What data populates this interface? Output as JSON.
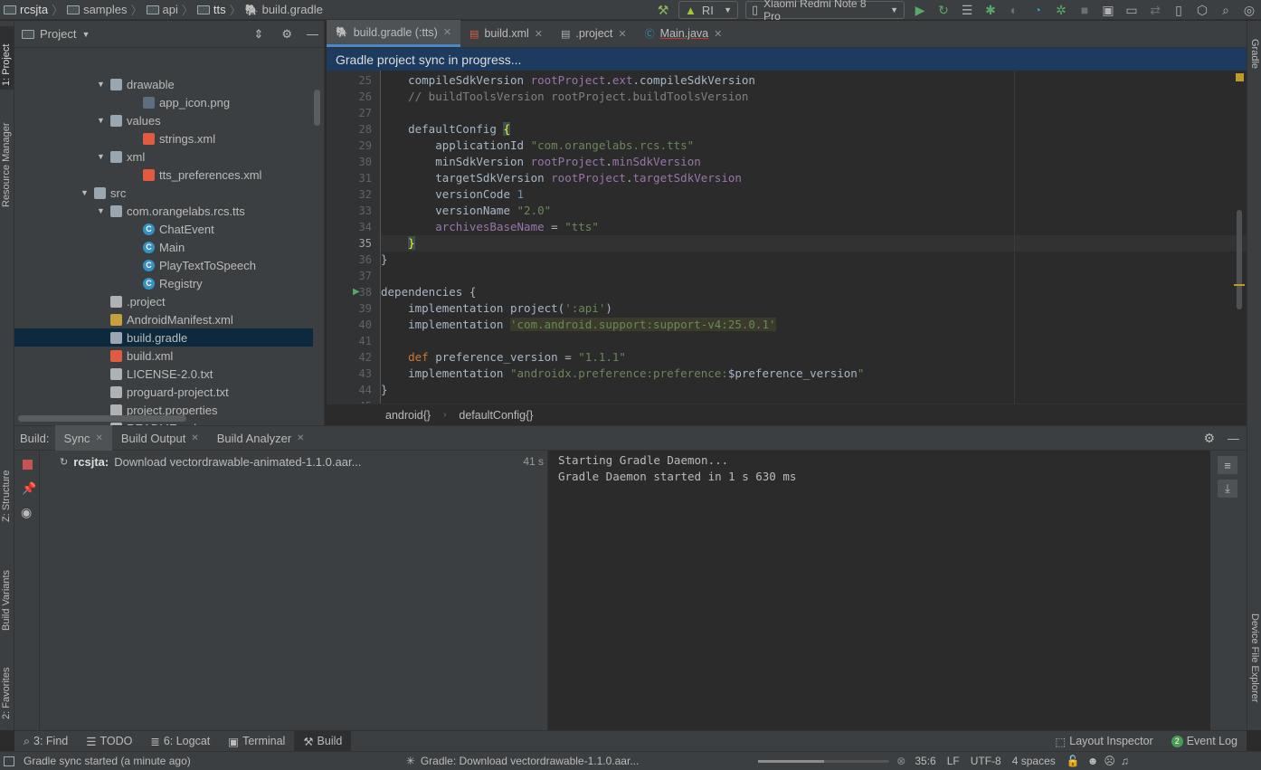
{
  "breadcrumbs": [
    "rcsjta",
    "samples",
    "api",
    "tts",
    "build.gradle"
  ],
  "toolbar": {
    "config_label": "RI",
    "device_label": "Xiaomi Redmi Note 8 Pro"
  },
  "left_strip": {
    "project": "1: Project",
    "resource_manager": "Resource Manager",
    "structure": "Z: Structure",
    "build_variants": "Build Variants",
    "favorites": "2: Favorites"
  },
  "right_strip": {
    "gradle": "Gradle",
    "device_file_explorer": "Device File Explorer"
  },
  "project_panel": {
    "title": "Project"
  },
  "tree": [
    {
      "label": "drawable",
      "type": "folder",
      "indent": 5,
      "expanded": true
    },
    {
      "label": "app_icon.png",
      "type": "png",
      "indent": 7
    },
    {
      "label": "values",
      "type": "folder",
      "indent": 5,
      "expanded": true
    },
    {
      "label": "strings.xml",
      "type": "xml",
      "indent": 7
    },
    {
      "label": "xml",
      "type": "folder",
      "indent": 5,
      "expanded": true
    },
    {
      "label": "tts_preferences.xml",
      "type": "xml",
      "indent": 7
    },
    {
      "label": "src",
      "type": "folder",
      "indent": 4,
      "expanded": true
    },
    {
      "label": "com.orangelabs.rcs.tts",
      "type": "package",
      "indent": 5,
      "expanded": true
    },
    {
      "label": "ChatEvent",
      "type": "class",
      "indent": 7
    },
    {
      "label": "Main",
      "type": "class",
      "indent": 7
    },
    {
      "label": "PlayTextToSpeech",
      "type": "class",
      "indent": 7
    },
    {
      "label": "Registry",
      "type": "class",
      "indent": 7
    },
    {
      "label": ".project",
      "type": "file",
      "indent": 5
    },
    {
      "label": "AndroidManifest.xml",
      "type": "manifest",
      "indent": 5
    },
    {
      "label": "build.gradle",
      "type": "gradle",
      "indent": 5,
      "selected": true
    },
    {
      "label": "build.xml",
      "type": "xml",
      "indent": 5
    },
    {
      "label": "LICENSE-2.0.txt",
      "type": "file",
      "indent": 5
    },
    {
      "label": "proguard-project.txt",
      "type": "file",
      "indent": 5
    },
    {
      "label": "project.properties",
      "type": "file",
      "indent": 5
    },
    {
      "label": "README.md",
      "type": "file",
      "indent": 5
    }
  ],
  "editor_tabs": [
    {
      "label": "build.gradle (:tts)",
      "active": true
    },
    {
      "label": "build.xml"
    },
    {
      "label": ".project"
    },
    {
      "label": "Main.java"
    }
  ],
  "sync_banner": "Gradle project sync in progress...",
  "code_lines": [
    {
      "n": "25",
      "html": "    compileSdkVersion <span class=\"fld\">rootProject</span>.<span class=\"fld\">ext</span>.compileSdkVersion"
    },
    {
      "n": "26",
      "html": "    <span class=\"cm\">// buildToolsVersion rootProject.buildToolsVersion</span>"
    },
    {
      "n": "27",
      "html": ""
    },
    {
      "n": "28",
      "html": "    defaultConfig <span class=\"brace\">{</span>"
    },
    {
      "n": "29",
      "html": "        applicationId <span class=\"str\">\"com.orangelabs.rcs.tts\"</span>"
    },
    {
      "n": "30",
      "html": "        minSdkVersion <span class=\"fld\">rootProject</span>.<span class=\"fld\">minSdkVersion</span>"
    },
    {
      "n": "31",
      "html": "        targetSdkVersion <span class=\"fld\">rootProject</span>.<span class=\"fld\">targetSdkVersion</span>"
    },
    {
      "n": "32",
      "html": "        versionCode <span class=\"num\">1</span>"
    },
    {
      "n": "33",
      "html": "        versionName <span class=\"str\">\"2.0\"</span>"
    },
    {
      "n": "34",
      "html": "        <span class=\"fld\">archivesBaseName</span> = <span class=\"str\">\"tts\"</span>"
    },
    {
      "n": "35",
      "html": "    <span class=\"brace\">}</span>",
      "current": true
    },
    {
      "n": "36",
      "html": "}"
    },
    {
      "n": "37",
      "html": ""
    },
    {
      "n": "38",
      "html": "dependencies {"
    },
    {
      "n": "39",
      "html": "    implementation project(<span class=\"str\">':api'</span>)"
    },
    {
      "n": "40",
      "html": "    implementation <span class=\"hl\">'com.android.support:support-v4:25.0.1'</span>"
    },
    {
      "n": "41",
      "html": ""
    },
    {
      "n": "42",
      "html": "    <span class=\"kw\">def</span> preference_version = <span class=\"str\">\"1.1.1\"</span>"
    },
    {
      "n": "43",
      "html": "    implementation <span class=\"str\">\"androidx.preference:preference:</span>$preference_version<span class=\"str\">\"</span>"
    },
    {
      "n": "44",
      "html": "}"
    },
    {
      "n": "45",
      "html": ""
    }
  ],
  "editor_breadcrumb": [
    "android{}",
    "defaultConfig{}"
  ],
  "build": {
    "label": "Build:",
    "tabs": [
      {
        "label": "Sync",
        "active": true
      },
      {
        "label": "Build Output"
      },
      {
        "label": "Build Analyzer"
      }
    ],
    "task_project": "rcsjta:",
    "task_text": "Download vectordrawable-animated-1.1.0.aar...",
    "task_time": "41 s",
    "console": [
      "Starting Gradle Daemon...",
      "Gradle Daemon started in 1 s 630 ms"
    ]
  },
  "bottom_tools": [
    {
      "label": "3: Find",
      "icon": "search-icon"
    },
    {
      "label": "TODO",
      "icon": "list-icon"
    },
    {
      "label": "6: Logcat",
      "icon": "logcat-icon"
    },
    {
      "label": "Terminal",
      "icon": "terminal-icon"
    },
    {
      "label": "Build",
      "icon": "hammer-icon",
      "active": true
    }
  ],
  "bottom_right_tools": [
    {
      "label": "Layout Inspector"
    },
    {
      "label": "Event Log",
      "badge": "2"
    }
  ],
  "status": {
    "left": "Gradle sync started (a minute ago)",
    "progress": "Gradle: Download vectordrawable-1.1.0.aar...",
    "position": "35:6",
    "line_sep": "LF",
    "encoding": "UTF-8",
    "indent": "4 spaces"
  }
}
